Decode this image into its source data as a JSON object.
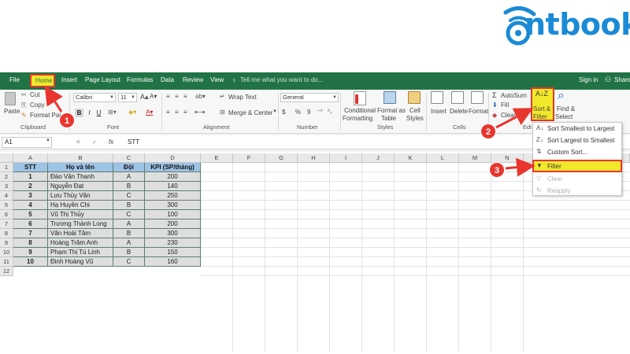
{
  "brand": {
    "name": "ntbook",
    "color": "#1a8ad6"
  },
  "tabs": [
    "File",
    "Home",
    "Insert",
    "Page Layout",
    "Formulas",
    "Data",
    "Review",
    "View"
  ],
  "tell_me": "Tell me what you want to do...",
  "account": {
    "sign_in": "Sign in",
    "share": "Share"
  },
  "clipboard": {
    "paste": "Paste",
    "cut": "Cut",
    "copy": "Copy",
    "format_painter": "Format Pai",
    "group": "Clipboard"
  },
  "font": {
    "name": "Calibri",
    "size": "11",
    "bold": "B",
    "italic": "I",
    "underline": "U",
    "group": "Font"
  },
  "alignment": {
    "wrap_text": "Wrap Text",
    "merge_center": "Merge & Center",
    "group": "Alignment"
  },
  "number": {
    "format": "General",
    "currency": "$",
    "percent": "%",
    "comma": "9",
    "group": "Number"
  },
  "styles": {
    "conditional": [
      "Conditional",
      "Formatting"
    ],
    "format_table": [
      "Format as",
      "Table"
    ],
    "cell_styles": [
      "Cell",
      "Styles"
    ],
    "group": "Styles"
  },
  "cells": {
    "insert": "Insert",
    "delete": "Delete",
    "format": "Format",
    "group": "Cells"
  },
  "editing": {
    "autosum": "AutoSum",
    "fill": "Fill",
    "clear": "Clear",
    "sort_filter": [
      "Sort &",
      "Filter"
    ],
    "find_select": [
      "Find &",
      "Select"
    ],
    "group": "Edi"
  },
  "formula_bar": {
    "cell_ref": "A1",
    "fx": "fx",
    "content": "STT"
  },
  "columns": [
    "A",
    "B",
    "C",
    "D",
    "E",
    "F",
    "G",
    "H",
    "I",
    "J",
    "K",
    "L",
    "M",
    "N"
  ],
  "rows": [
    "1",
    "2",
    "3",
    "4",
    "5",
    "6",
    "7",
    "8",
    "9",
    "10",
    "11",
    "12"
  ],
  "table": {
    "headers": [
      "STT",
      "Họ và tên",
      "Đội",
      "KPI (SP/tháng)"
    ],
    "rows": [
      [
        "1",
        "Đào Văn Thanh",
        "A",
        "200"
      ],
      [
        "2",
        "Nguyễn Đạt",
        "B",
        "140"
      ],
      [
        "3",
        "Lưu Thùy Vân",
        "C",
        "250"
      ],
      [
        "4",
        "Hạ Huyền Chi",
        "B",
        "300"
      ],
      [
        "5",
        "Vũ Thị Thủy",
        "C",
        "100"
      ],
      [
        "6",
        "Trương Thành Long",
        "A",
        "200"
      ],
      [
        "7",
        "Văn Hoài Tâm",
        "B",
        "300"
      ],
      [
        "8",
        "Hoàng Trâm Anh",
        "A",
        "230"
      ],
      [
        "9",
        "Phạm Thị Tú Linh",
        "B",
        "150"
      ],
      [
        "10",
        "Đinh Hoàng Vũ",
        "C",
        "160"
      ]
    ]
  },
  "sort_menu": {
    "sort_asc": "Sort Smallest to Largest",
    "sort_desc": "Sort Largest to Smallest",
    "custom_sort": "Custom Sort...",
    "filter": "Filter",
    "clear": "Clear",
    "reapply": "Reapply"
  },
  "steps": [
    "1",
    "2",
    "3"
  ],
  "colors": {
    "excel_green": "#217346",
    "highlight": "#f3e92b",
    "annotation_red": "#e8362f",
    "header_blue": "#9dc3e6"
  }
}
